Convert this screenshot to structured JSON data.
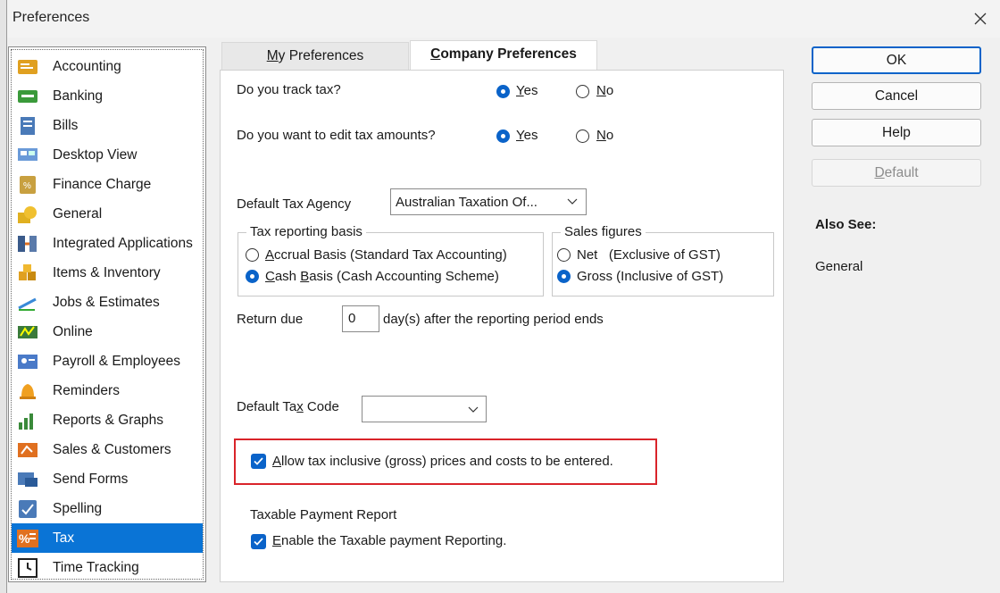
{
  "window": {
    "title": "Preferences"
  },
  "sidebar": {
    "items": [
      {
        "label": "Accounting",
        "icon": "accounting-icon"
      },
      {
        "label": "Banking",
        "icon": "banking-icon"
      },
      {
        "label": "Bills",
        "icon": "bills-icon"
      },
      {
        "label": "Desktop View",
        "icon": "desktop-view-icon"
      },
      {
        "label": "Finance Charge",
        "icon": "finance-charge-icon"
      },
      {
        "label": "General",
        "icon": "general-icon"
      },
      {
        "label": "Integrated Applications",
        "icon": "integrated-applications-icon"
      },
      {
        "label": "Items & Inventory",
        "icon": "items-inventory-icon"
      },
      {
        "label": "Jobs & Estimates",
        "icon": "jobs-estimates-icon"
      },
      {
        "label": "Online",
        "icon": "online-icon"
      },
      {
        "label": "Payroll & Employees",
        "icon": "payroll-employees-icon"
      },
      {
        "label": "Reminders",
        "icon": "reminders-icon"
      },
      {
        "label": "Reports & Graphs",
        "icon": "reports-graphs-icon"
      },
      {
        "label": "Sales & Customers",
        "icon": "sales-customers-icon"
      },
      {
        "label": "Send Forms",
        "icon": "send-forms-icon"
      },
      {
        "label": "Spelling",
        "icon": "spelling-icon"
      },
      {
        "label": "Tax",
        "icon": "tax-icon",
        "selected": true
      },
      {
        "label": "Time Tracking",
        "icon": "time-tracking-icon"
      }
    ]
  },
  "tabs": {
    "my_pre": "M",
    "my_rest": "y Preferences",
    "co_pre": "C",
    "co_rest": "ompany Preferences"
  },
  "tax": {
    "track_q": "Do you track tax?",
    "edit_q": "Do you want to edit tax amounts?",
    "yes_u": "Y",
    "yes_rest": "es",
    "no_u": "N",
    "no_rest": "o",
    "track_value": "Yes",
    "edit_value": "Yes",
    "agency_label": "Default Tax Agency",
    "agency_value": "Australian Taxation Of...",
    "basis_legend": "Tax reporting basis",
    "accrual_u": "A",
    "accrual_rest": "ccrual Basis (Standard Tax Accounting)",
    "cash_u": "C",
    "cash_mid": "ash ",
    "cash_u2": "B",
    "cash_rest": "asis (Cash Accounting Scheme)",
    "basis_value": "Cash Basis",
    "sales_legend": "Sales figures",
    "net_label": "Net   (Exclusive of GST)",
    "gross_label": "Gross (Inclusive of GST)",
    "sales_value": "Gross",
    "return_due_label": "Return due",
    "return_due_value": "0",
    "return_due_suffix": "day(s) after the reporting period ends",
    "code_pre": "Default Ta",
    "code_u": "x",
    "code_rest": " Code",
    "code_value": "",
    "allow_u": "A",
    "allow_rest": "llow tax inclusive (gross) prices and costs to be entered.",
    "allow_checked": true,
    "tpr_heading": "Taxable Payment Report",
    "tpr_u": "E",
    "tpr_rest": "nable the Taxable payment Reporting.",
    "tpr_checked": true
  },
  "buttons": {
    "ok": "OK",
    "cancel": "Cancel",
    "help": "Help",
    "default_u": "D",
    "default_rest": "efault"
  },
  "also_see": {
    "heading": "Also See:",
    "link": "General"
  },
  "colors": {
    "accent": "#0a63c9",
    "selection": "#0a74d6",
    "highlight_box": "#d9242a"
  }
}
